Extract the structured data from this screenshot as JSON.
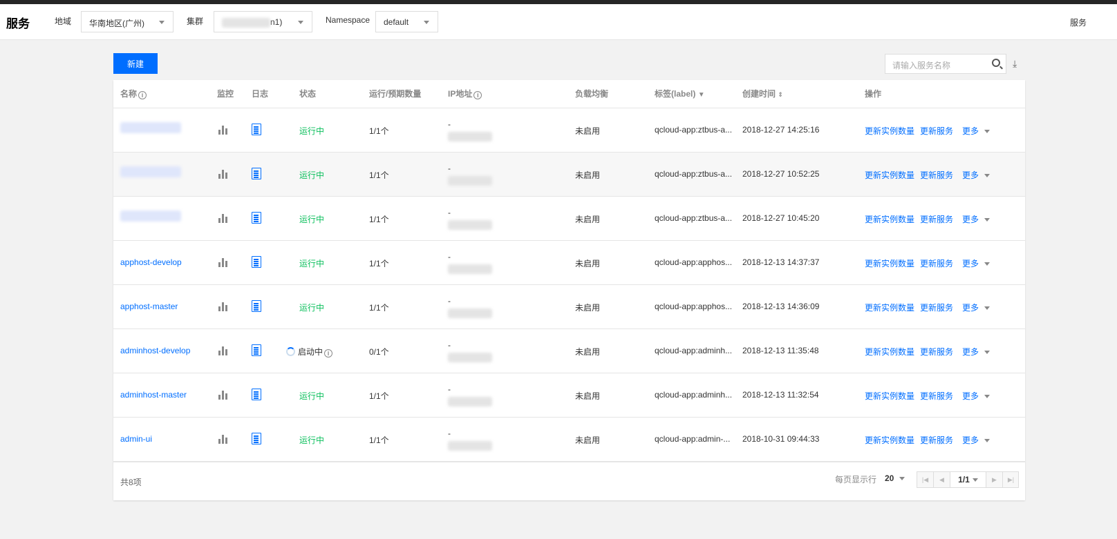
{
  "header": {
    "title": "服务",
    "region_label": "地域",
    "region_value": "华南地区(广州)",
    "cluster_label": "集群",
    "cluster_value_suffix": "n1)",
    "namespace_label": "Namespace",
    "namespace_value": "default",
    "right_text": "服务"
  },
  "toolbar": {
    "new_button": "新建",
    "search_placeholder": "请输入服务名称",
    "download_icon": "⤓"
  },
  "table": {
    "columns": [
      "名称",
      "监控",
      "日志",
      "状态",
      "运行/预期数量",
      "IP地址",
      "负载均衡",
      "标签(label)",
      "创建时间",
      "操作"
    ],
    "rows": [
      {
        "name": "",
        "status": "运行中",
        "count": "1/1个",
        "ip": "-",
        "lb": "未启用",
        "label": "qcloud-app:ztbus-a...",
        "created": "2018-12-27 14:25:16"
      },
      {
        "name": "",
        "status": "运行中",
        "count": "1/1个",
        "ip": "-",
        "lb": "未启用",
        "label": "qcloud-app:ztbus-a...",
        "created": "2018-12-27 10:52:25"
      },
      {
        "name": "",
        "status": "运行中",
        "count": "1/1个",
        "ip": "-",
        "lb": "未启用",
        "label": "qcloud-app:ztbus-a...",
        "created": "2018-12-27 10:45:20"
      },
      {
        "name": "apphost-develop",
        "status": "运行中",
        "count": "1/1个",
        "ip": "-",
        "lb": "未启用",
        "label": "qcloud-app:apphos...",
        "created": "2018-12-13 14:37:37"
      },
      {
        "name": "apphost-master",
        "status": "运行中",
        "count": "1/1个",
        "ip": "-",
        "lb": "未启用",
        "label": "qcloud-app:apphos...",
        "created": "2018-12-13 14:36:09"
      },
      {
        "name": "adminhost-develop",
        "status": "启动中",
        "count": "0/1个",
        "ip": "-",
        "lb": "未启用",
        "label": "qcloud-app:adminh...",
        "created": "2018-12-13 11:35:48"
      },
      {
        "name": "adminhost-master",
        "status": "运行中",
        "count": "1/1个",
        "ip": "-",
        "lb": "未启用",
        "label": "qcloud-app:adminh...",
        "created": "2018-12-13 11:32:54"
      },
      {
        "name": "admin-ui",
        "status": "运行中",
        "count": "1/1个",
        "ip": "-",
        "lb": "未启用",
        "label": "qcloud-app:admin-...",
        "created": "2018-10-31 09:44:33"
      }
    ],
    "actions": [
      "更新实例数量",
      "更新服务",
      "更多"
    ]
  },
  "footer": {
    "total": "共8项",
    "page_size_label": "每页显示行",
    "page_size": "20",
    "page": "1/1"
  },
  "colors": {
    "accent": "#006eff",
    "running": "#0abf5b"
  }
}
